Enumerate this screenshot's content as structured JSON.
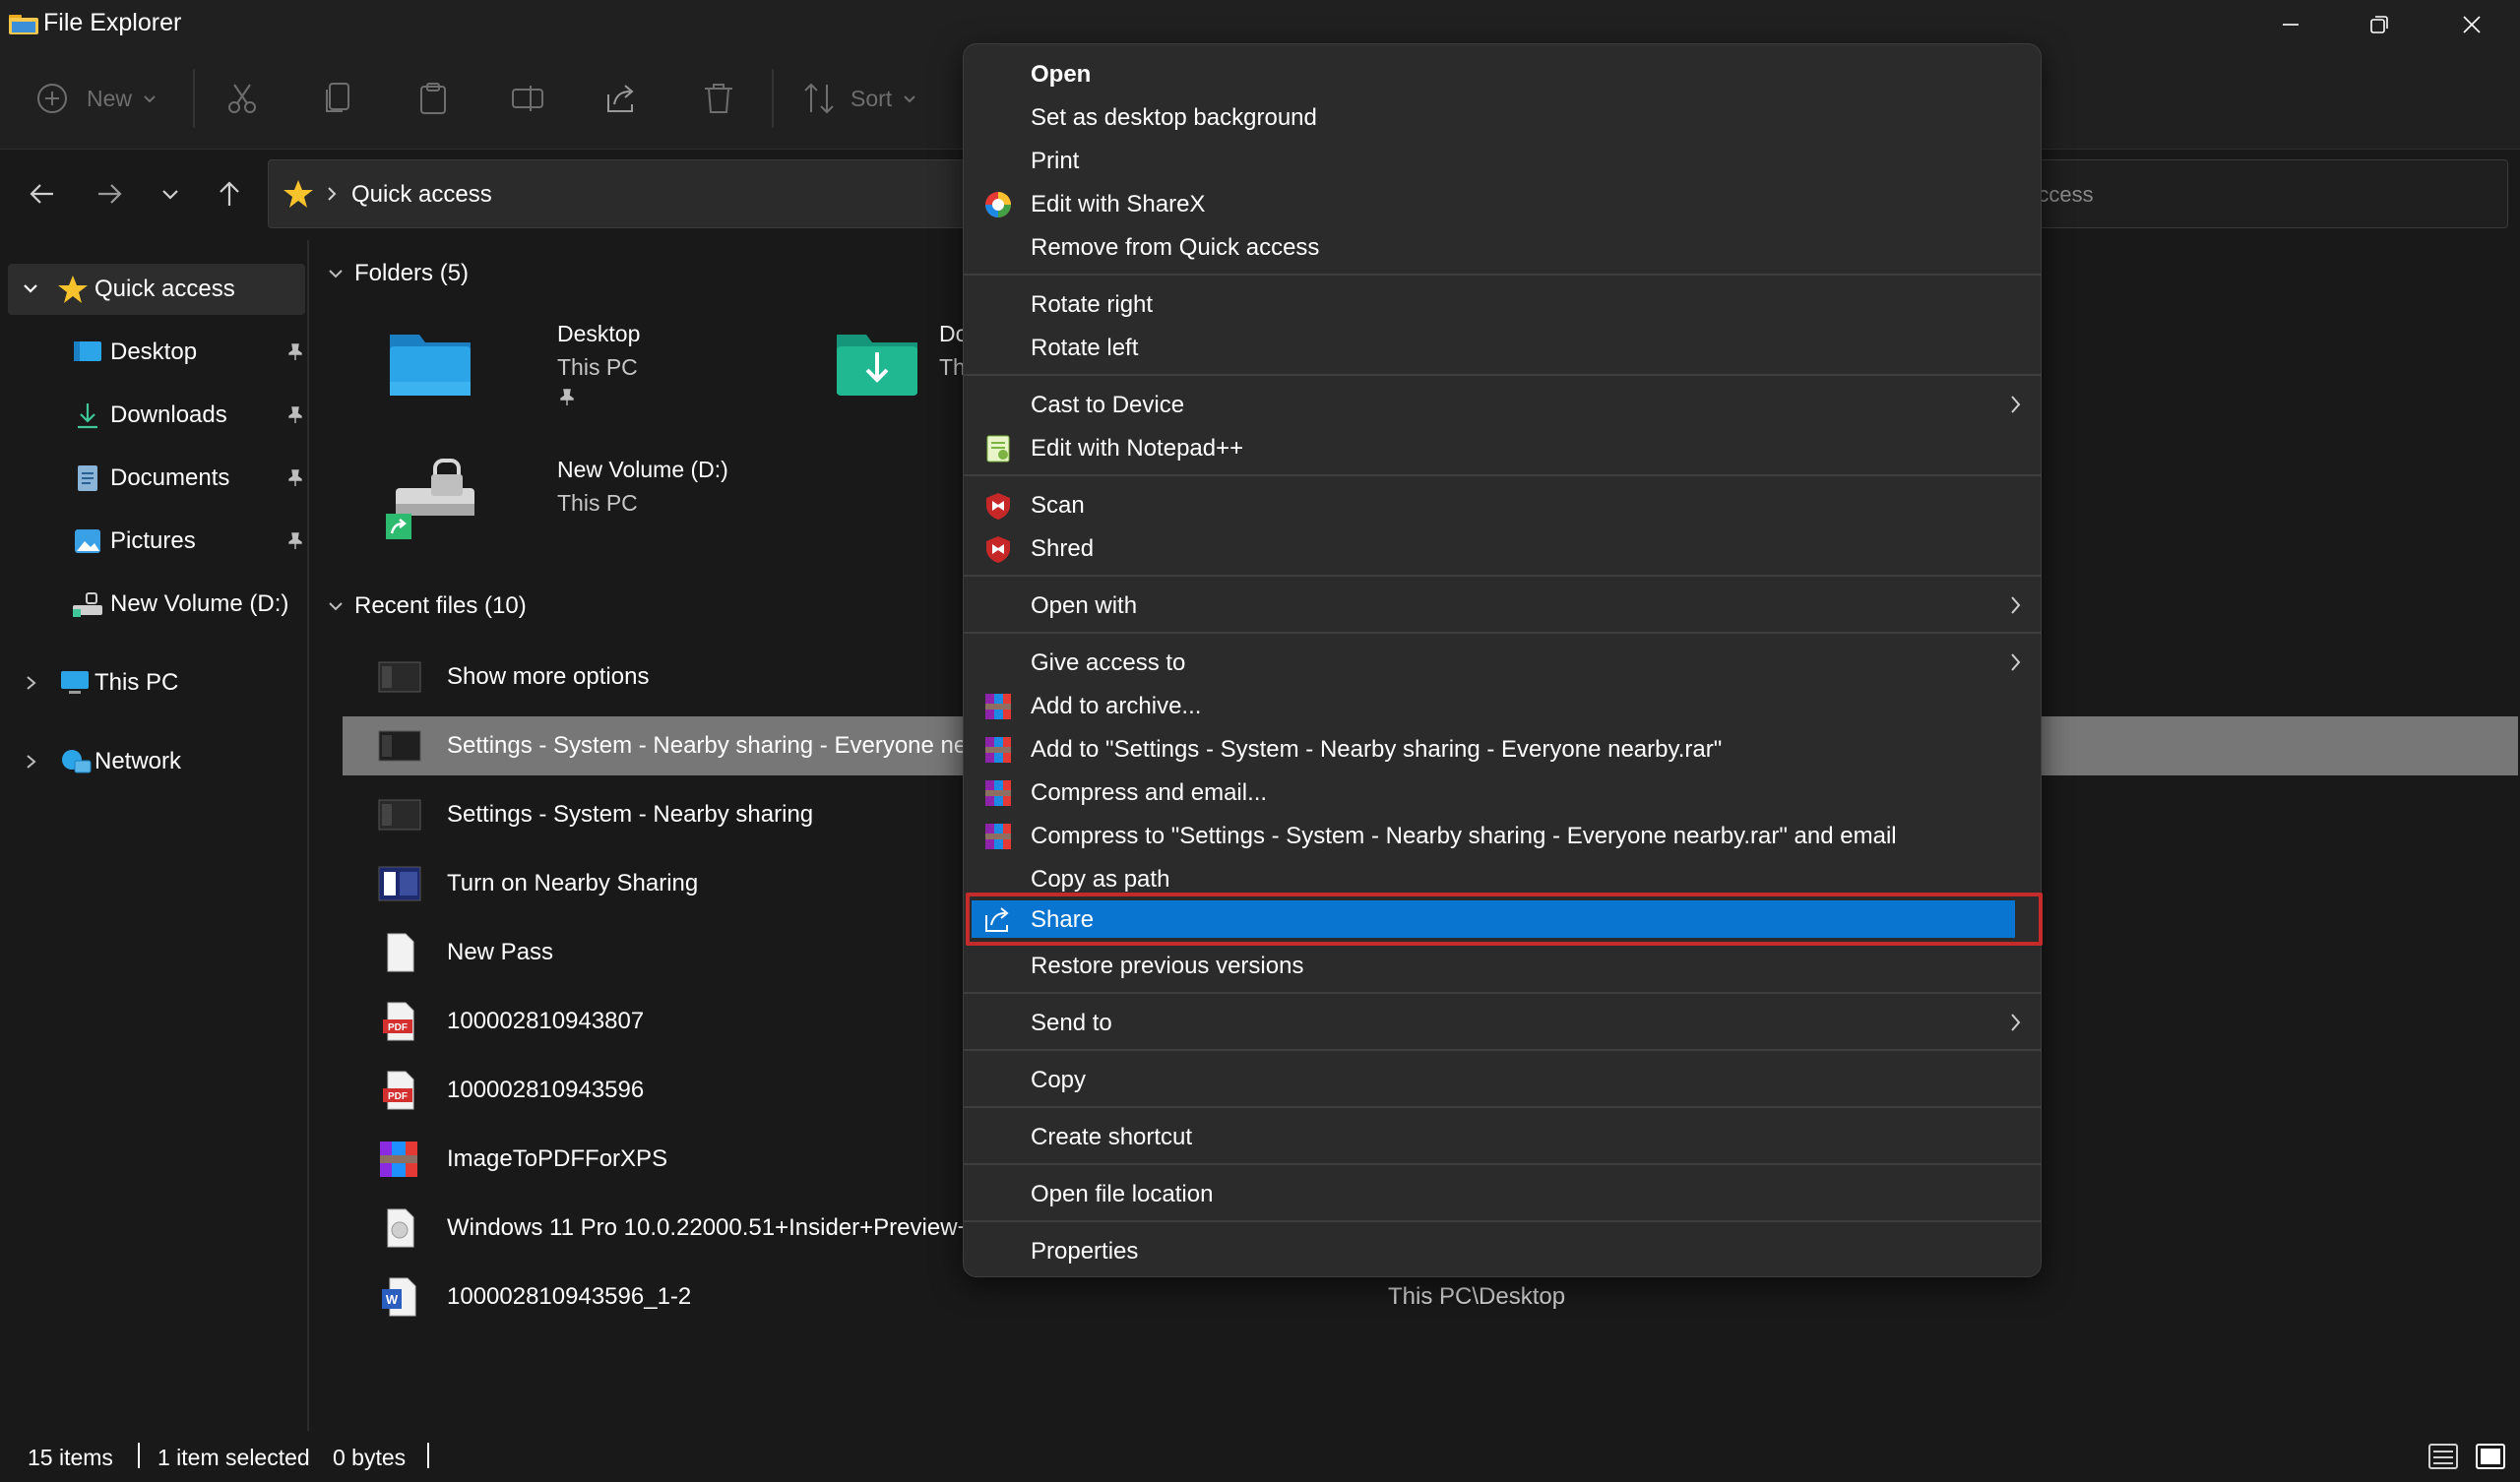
{
  "window": {
    "title": "File Explorer",
    "minimize_icon": "minimize-icon",
    "maximize_icon": "restore-icon",
    "close_icon": "close-icon"
  },
  "toolbar": {
    "new_label": "New",
    "sort_label": "Sort",
    "disabled_color": "#6e6e6e"
  },
  "address": {
    "location": "Quick access",
    "search_placeholder": "k access"
  },
  "sidebar": {
    "items": [
      {
        "label": "Quick access",
        "icon": "star-icon"
      },
      {
        "label": "Desktop",
        "icon": "desktop-icon"
      },
      {
        "label": "Downloads",
        "icon": "download-icon"
      },
      {
        "label": "Documents",
        "icon": "document-icon"
      },
      {
        "label": "Pictures",
        "icon": "pictures-icon"
      },
      {
        "label": "New Volume (D:)",
        "icon": "drive-icon"
      },
      {
        "label": "This PC",
        "icon": "pc-icon"
      },
      {
        "label": "Network",
        "icon": "network-icon"
      }
    ]
  },
  "folders": {
    "header": "Folders (5)",
    "items": [
      {
        "name": "Desktop",
        "location": "This PC"
      },
      {
        "name": "Do",
        "location": "Th"
      },
      {
        "name": "New Volume (D:)",
        "location": "This PC"
      }
    ]
  },
  "recent": {
    "header": "Recent files (10)",
    "items": [
      {
        "name": "Show more options",
        "location": ""
      },
      {
        "name": "Settings - System - Nearby sharing - Everyone ne",
        "location": ""
      },
      {
        "name": "Settings - System - Nearby sharing",
        "location": ""
      },
      {
        "name": "Turn on Nearby Sharing",
        "location": ""
      },
      {
        "name": "New Pass",
        "location": ""
      },
      {
        "name": "100002810943807",
        "location": ""
      },
      {
        "name": "100002810943596",
        "location": ""
      },
      {
        "name": "ImageToPDFForXPS",
        "location": ""
      },
      {
        "name": "Windows 11 Pro 10.0.22000.51+Insider+Preview+",
        "location": ""
      },
      {
        "name": "100002810943596_1-2",
        "location": "This PC\\Desktop"
      }
    ]
  },
  "status": {
    "items_count": "15 items",
    "selected": "1 item selected",
    "size": "0 bytes"
  },
  "context_menu": {
    "open": "Open",
    "set_background": "Set as desktop background",
    "print": "Print",
    "edit_sharex": "Edit with ShareX",
    "remove_quick": "Remove from Quick access",
    "rotate_right": "Rotate right",
    "rotate_left": "Rotate left",
    "cast": "Cast to Device",
    "edit_notepad": "Edit with Notepad++",
    "scan": "Scan",
    "shred": "Shred",
    "open_with": "Open with",
    "give_access": "Give access to",
    "add_archive": "Add to archive...",
    "add_rar": "Add to \"Settings - System - Nearby sharing - Everyone nearby.rar\"",
    "compress_email": "Compress and email...",
    "compress_rar_email": "Compress to \"Settings - System - Nearby sharing - Everyone nearby.rar\" and email",
    "copy_path": "Copy as path",
    "share": "Share",
    "restore": "Restore previous versions",
    "send_to": "Send to",
    "copy": "Copy",
    "create_shortcut": "Create shortcut",
    "open_location": "Open file location",
    "properties": "Properties",
    "highlight_color": "#0a74d1",
    "annotation_color": "#c42b2b"
  }
}
